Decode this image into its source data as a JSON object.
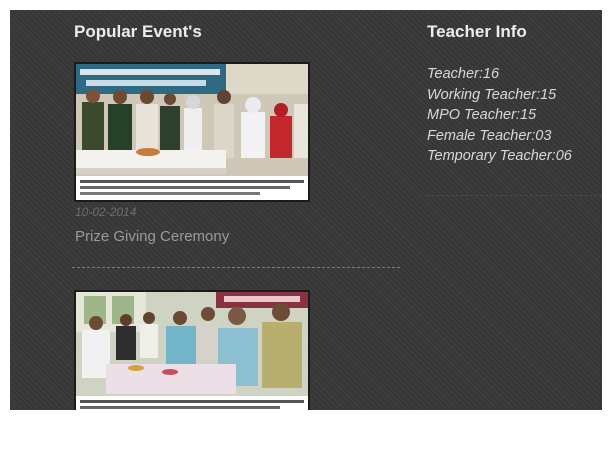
{
  "events": {
    "heading": "Popular Event's",
    "items": [
      {
        "date": "10-02-2014",
        "title": "Prize Giving Ceremony",
        "photo": "award-ceremony-photo"
      },
      {
        "photo": "event-group-photo"
      }
    ]
  },
  "teacher_info": {
    "heading": "Teacher Info",
    "lines": [
      "Teacher:16",
      "Working Teacher:15",
      "MPO Teacher:15",
      "Female Teacher:03",
      "Temporary Teacher:06"
    ]
  },
  "colors": {
    "panel_background": "#383838",
    "heading_text": "#ececec",
    "date_text": "#6d6d6d",
    "event_title_text": "#9a9a9a",
    "teacher_text": "#d8d8d8"
  }
}
